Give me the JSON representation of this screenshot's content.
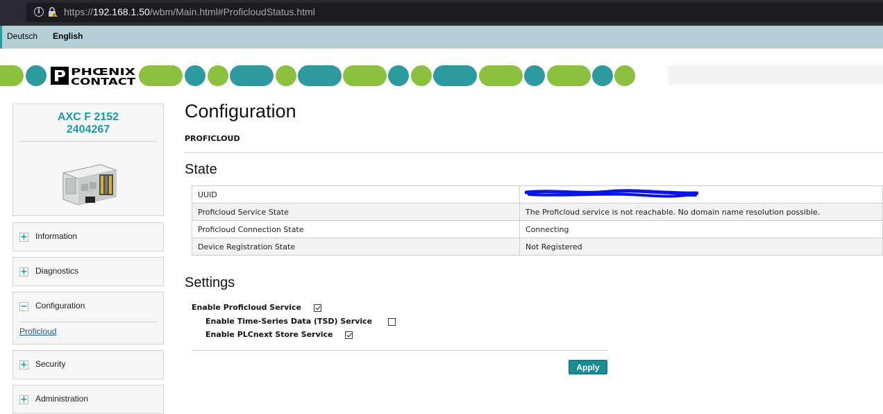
{
  "browser": {
    "url_prefix": "https://",
    "url_host": "192.168.1.50",
    "url_path": "/wbm/Main.html#ProficloudStatus.html"
  },
  "languages": {
    "deutsch": "Deutsch",
    "english": "English"
  },
  "brand": {
    "logo_line1": "PHŒNIX",
    "logo_line2": "CONTACT"
  },
  "device": {
    "model": "AXC F 2152",
    "article": "2404267"
  },
  "nav": {
    "information": "Information",
    "diagnostics": "Diagnostics",
    "configuration": "Configuration",
    "configuration_sub": "Proficloud",
    "security": "Security",
    "administration": "Administration"
  },
  "main": {
    "title": "Configuration",
    "section": "PROFICLOUD",
    "state_heading": "State",
    "state_rows": [
      {
        "key": "UUID",
        "value": ""
      },
      {
        "key": "Proficloud Service State",
        "value": "The Proficloud service is not reachable. No domain name resolution possible."
      },
      {
        "key": "Proficloud Connection State",
        "value": "Connecting"
      },
      {
        "key": "Device Registration State",
        "value": "Not Registered"
      }
    ],
    "settings_heading": "Settings",
    "settings": [
      {
        "label": "Enable Proficloud Service",
        "checked": true
      },
      {
        "label": "Enable Time-Series Data (TSD) Service",
        "checked": false
      },
      {
        "label": "Enable PLCnext Store Service",
        "checked": true
      }
    ],
    "apply_label": "Apply"
  },
  "colors": {
    "accent_teal": "#2c9a9f",
    "accent_green": "#8cc140",
    "button": "#1a8a93"
  }
}
